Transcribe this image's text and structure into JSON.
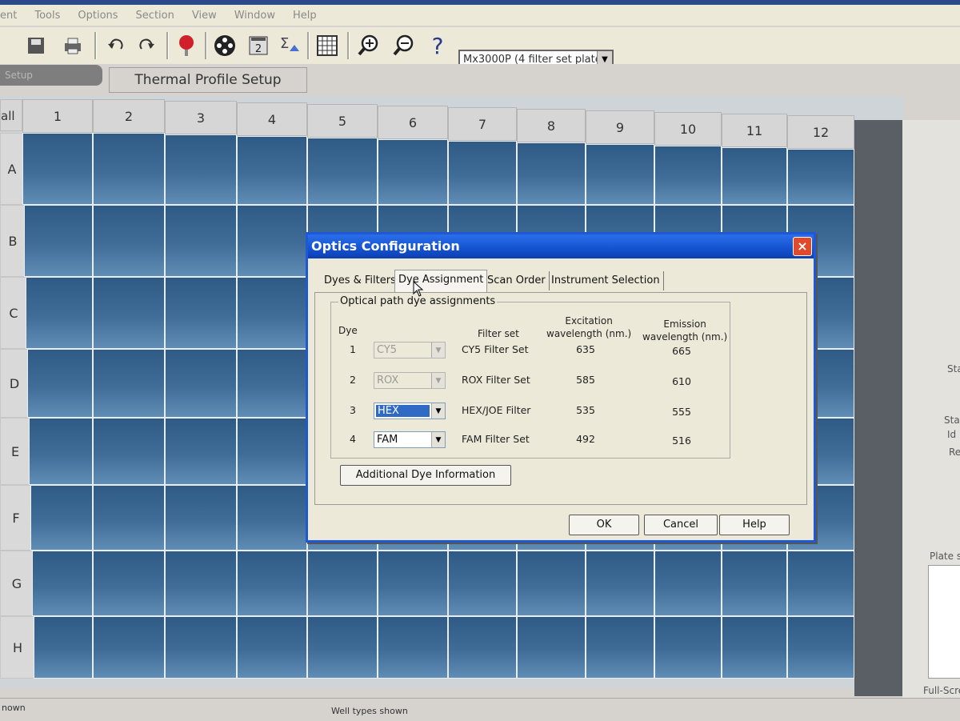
{
  "menu": [
    "ent",
    "Tools",
    "Options",
    "Section",
    "View",
    "Window",
    "Help"
  ],
  "toolbar": {
    "instrument_value": "Mx3000P (4 filter set plate)",
    "icons": [
      "save-icon",
      "print-icon",
      "undo-icon",
      "redo-icon",
      "stop-icon",
      "run-icon",
      "calculator-icon",
      "sum-icon",
      "grid-icon",
      "zoom-in-icon",
      "zoom-out-icon",
      "help-icon"
    ],
    "help_glyph": "?"
  },
  "tabs": {
    "setup": "Setup",
    "thermal": "Thermal Profile Setup"
  },
  "plate": {
    "corner": "all",
    "columns": [
      "1",
      "2",
      "3",
      "4",
      "5",
      "6",
      "7",
      "8",
      "9",
      "10",
      "11",
      "12"
    ],
    "rows": [
      "A",
      "B",
      "C",
      "D",
      "E",
      "F",
      "G",
      "H"
    ]
  },
  "right_panel": {
    "sta1": "Sta",
    "sta2": "Sta",
    "id": "Id",
    "re": "Re",
    "plate_s": "Plate s",
    "full_screen": "Full-Scre"
  },
  "status": {
    "left": "nown",
    "mid": "Well types shown"
  },
  "dialog": {
    "title": "Optics Configuration",
    "close_glyph": "×",
    "tabs": [
      "Dyes & Filters",
      "Dye Assignment",
      "Scan Order",
      "Instrument Selection"
    ],
    "group_label": "Optical path dye assignments",
    "headers": {
      "dye": "Dye",
      "filter_set": "Filter set",
      "excitation": "Excitation\nwavelength (nm.)",
      "emission": "Emission\nwavelength (nm.)"
    },
    "rows": [
      {
        "num": "1",
        "dye": "CY5",
        "filter": "CY5 Filter Set",
        "excitation": "635",
        "emission": "665"
      },
      {
        "num": "2",
        "dye": "ROX",
        "filter": "ROX Filter Set",
        "excitation": "585",
        "emission": "610"
      },
      {
        "num": "3",
        "dye": "HEX",
        "filter": "HEX/JOE Filter",
        "excitation": "535",
        "emission": "555"
      },
      {
        "num": "4",
        "dye": "FAM",
        "filter": "FAM Filter Set",
        "excitation": "492",
        "emission": "516"
      }
    ],
    "additional_button": "Additional Dye Information",
    "ok": "OK",
    "cancel": "Cancel",
    "help": "Help"
  },
  "colors": {
    "title_blue": "#1452d0",
    "close_red": "#e04a2c",
    "well_blue": "#3f6d98",
    "selection": "#316ac5"
  }
}
